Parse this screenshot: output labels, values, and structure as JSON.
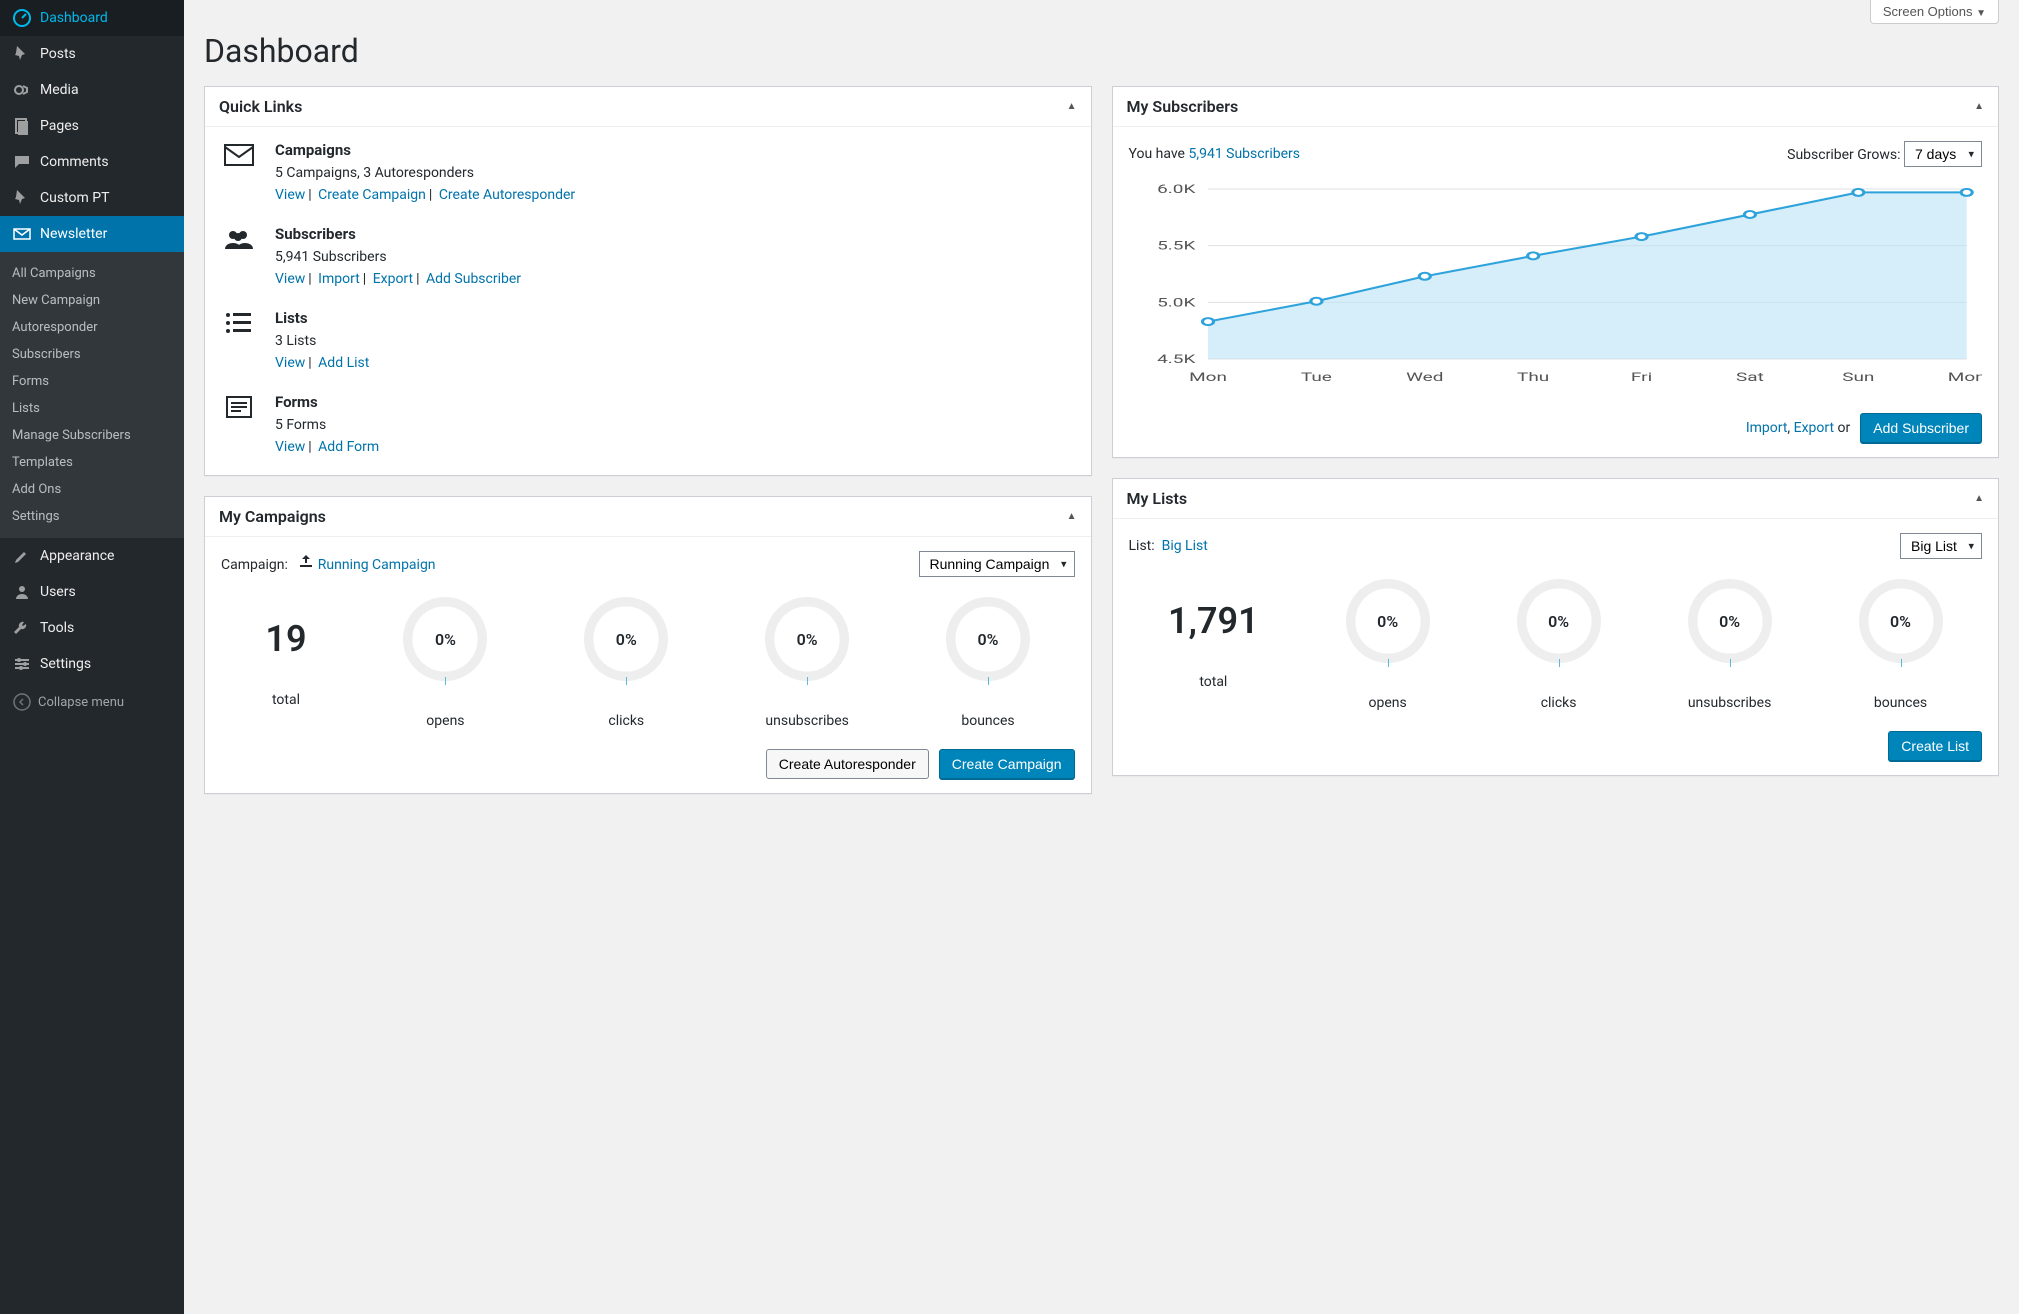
{
  "screen_options": "Screen Options",
  "page_title": "Dashboard",
  "sidebar": {
    "items": [
      {
        "label": "Dashboard"
      },
      {
        "label": "Posts"
      },
      {
        "label": "Media"
      },
      {
        "label": "Pages"
      },
      {
        "label": "Comments"
      },
      {
        "label": "Custom PT"
      },
      {
        "label": "Newsletter"
      },
      {
        "label": "Appearance"
      },
      {
        "label": "Users"
      },
      {
        "label": "Tools"
      },
      {
        "label": "Settings"
      }
    ],
    "submenu": [
      "All Campaigns",
      "New Campaign",
      "Autoresponder",
      "Subscribers",
      "Forms",
      "Lists",
      "Manage Subscribers",
      "Templates",
      "Add Ons",
      "Settings"
    ],
    "collapse": "Collapse menu"
  },
  "quick_links": {
    "title": "Quick Links",
    "campaigns": {
      "title": "Campaigns",
      "subtitle": "5 Campaigns, 3 Autoresponders",
      "view": "View",
      "create": "Create Campaign",
      "create_auto": "Create Autoresponder"
    },
    "subscribers": {
      "title": "Subscribers",
      "subtitle": "5,941 Subscribers",
      "view": "View",
      "import": "Import",
      "export": "Export",
      "add": "Add Subscriber"
    },
    "lists": {
      "title": "Lists",
      "subtitle": "3 Lists",
      "view": "View",
      "add": "Add List"
    },
    "forms": {
      "title": "Forms",
      "subtitle": "5 Forms",
      "view": "View",
      "add": "Add Form"
    }
  },
  "my_campaigns": {
    "title": "My Campaigns",
    "label": "Campaign:",
    "current": "Running Campaign",
    "dropdown": "Running Campaign",
    "total": "19",
    "total_label": "total",
    "opens": "0%",
    "opens_label": "opens",
    "clicks": "0%",
    "clicks_label": "clicks",
    "unsub": "0%",
    "unsub_label": "unsubscribes",
    "bounces": "0%",
    "bounces_label": "bounces",
    "create_auto": "Create Autoresponder",
    "create_campaign": "Create Campaign"
  },
  "my_subscribers": {
    "title": "My Subscribers",
    "you_have_prefix": "You have ",
    "count_link": "5,941 Subscribers",
    "grows_label": "Subscriber Grows:",
    "grows_value": "7 days",
    "import": "Import",
    "export": "Export",
    "or": " or ",
    "add": "Add Subscriber",
    "sep": ", "
  },
  "chart_data": {
    "type": "line",
    "title": "",
    "xlabel": "",
    "ylabel": "",
    "categories": [
      "Mon",
      "Tue",
      "Wed",
      "Thu",
      "Fri",
      "Sat",
      "Sun",
      "Mon"
    ],
    "values": [
      4830,
      5010,
      5230,
      5410,
      5580,
      5775,
      5970,
      5970
    ],
    "y_ticks": [
      "4.5K",
      "5.0K",
      "5.5K",
      "6.0K"
    ],
    "ylim": [
      4500,
      6000
    ]
  },
  "my_lists": {
    "title": "My Lists",
    "label": "List:",
    "current": "Big List",
    "dropdown": "Big List",
    "total": "1,791",
    "total_label": "total",
    "opens": "0%",
    "opens_label": "opens",
    "clicks": "0%",
    "clicks_label": "clicks",
    "unsub": "0%",
    "unsub_label": "unsubscribes",
    "bounces": "0%",
    "bounces_label": "bounces",
    "create": "Create List"
  }
}
